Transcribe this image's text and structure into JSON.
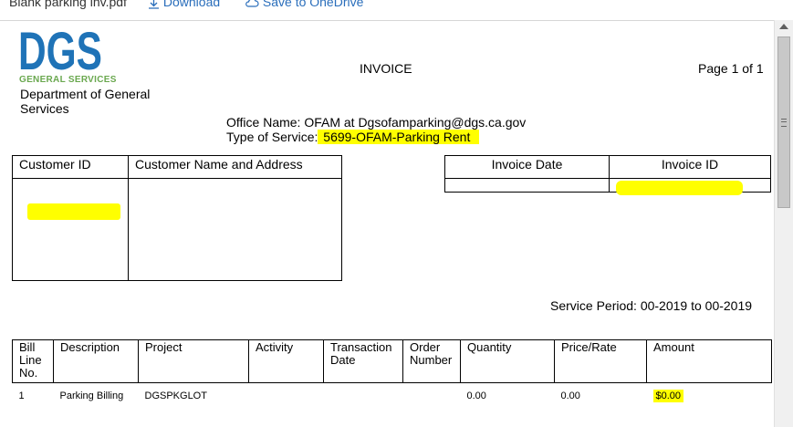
{
  "toolbar": {
    "filename": "Blank parking inv.pdf",
    "download_label": "Download",
    "onedrive_label": "Save to OneDrive"
  },
  "header": {
    "logo_text": "DGS",
    "logo_subtext": "GENERAL SERVICES",
    "department": "Department of General Services",
    "title": "INVOICE",
    "page": "Page 1 of 1"
  },
  "office": {
    "name_line": "Office Name: OFAM at Dgsofamparking@dgs.ca.gov",
    "service_label": "Type of Service:",
    "service_value": "5699-OFAM-Parking Rent"
  },
  "customer_table": {
    "col1": "Customer ID",
    "col2": "Customer Name and Address",
    "customer_id": "",
    "customer_name_address": ""
  },
  "invoice_table": {
    "col1": "Invoice Date",
    "col2": "Invoice ID",
    "invoice_date": "",
    "invoice_id": ""
  },
  "service_period": "Service Period: 00-2019 to 00-2019",
  "line_items": {
    "headers": [
      "Bill Line No.",
      "Description",
      "Project",
      "Activity",
      "Transaction Date",
      "Order Number",
      "Quantity",
      "Price/Rate",
      "Amount"
    ],
    "rows": [
      {
        "line": "1",
        "description": "Parking Billing",
        "project": "DGSPKGLOT",
        "activity": "",
        "transaction_date": "",
        "order_number": "",
        "quantity": "0.00",
        "price": "0.00",
        "amount": "$0.00"
      }
    ]
  },
  "colors": {
    "logo_blue": "#1f73b7",
    "logo_green": "#6aa84f",
    "highlight": "#ffff00",
    "link": "#2a6ebb"
  }
}
